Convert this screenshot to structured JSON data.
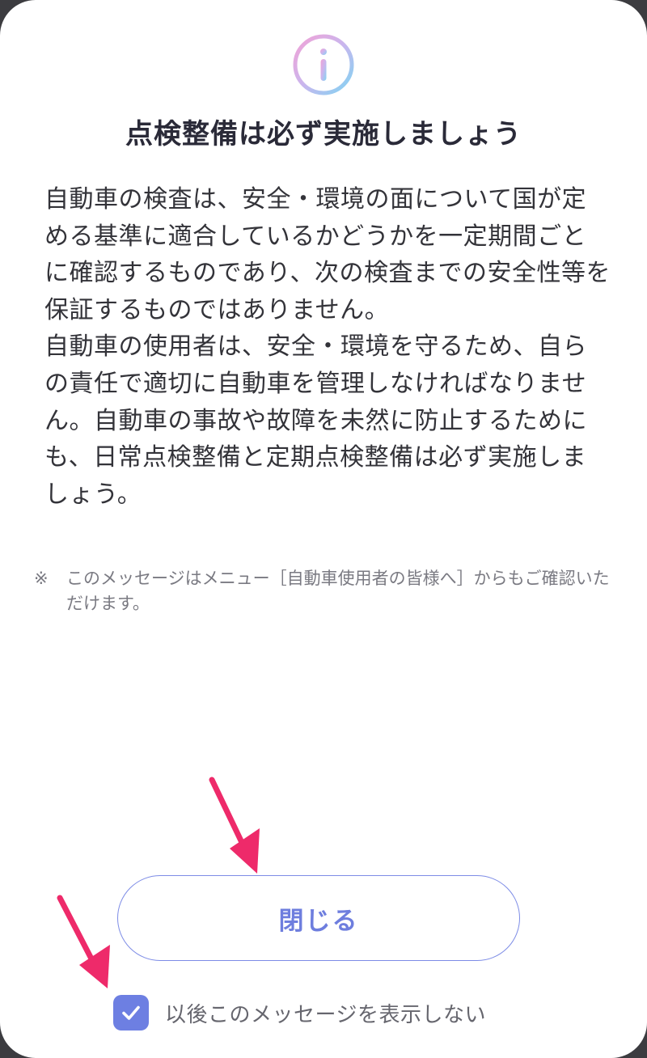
{
  "dialog": {
    "icon": "info-icon",
    "title": "点検整備は必ず実施しましょう",
    "body_paragraphs": [
      "自動車の検査は、安全・環境の面について国が定める基準に適合しているかどうかを一定期間ごとに確認するものであり、次の検査までの安全性等を保証するものではありません。",
      "自動車の使用者は、安全・環境を守るため、自らの責任で適切に自動車を管理しなければなりません。自動車の事故や故障を未然に防止するためにも、日常点検整備と定期点検整備は必ず実施しましょう。"
    ],
    "note_mark": "※",
    "note": "このメッセージはメニュー［自動車使用者の皆様へ］からもご確認いただけます。",
    "close_label": "閉じる",
    "checkbox": {
      "label": "以後このメッセージを表示しない",
      "checked": true
    }
  },
  "colors": {
    "accent": "#6d7fe2",
    "annotation_arrow": "#ee2a6a",
    "icon_gradient_start": "#f0a6d8",
    "icon_gradient_end": "#86d2f0"
  },
  "annotations": {
    "arrows": [
      "arrow-to-close-button",
      "arrow-to-checkbox"
    ]
  }
}
